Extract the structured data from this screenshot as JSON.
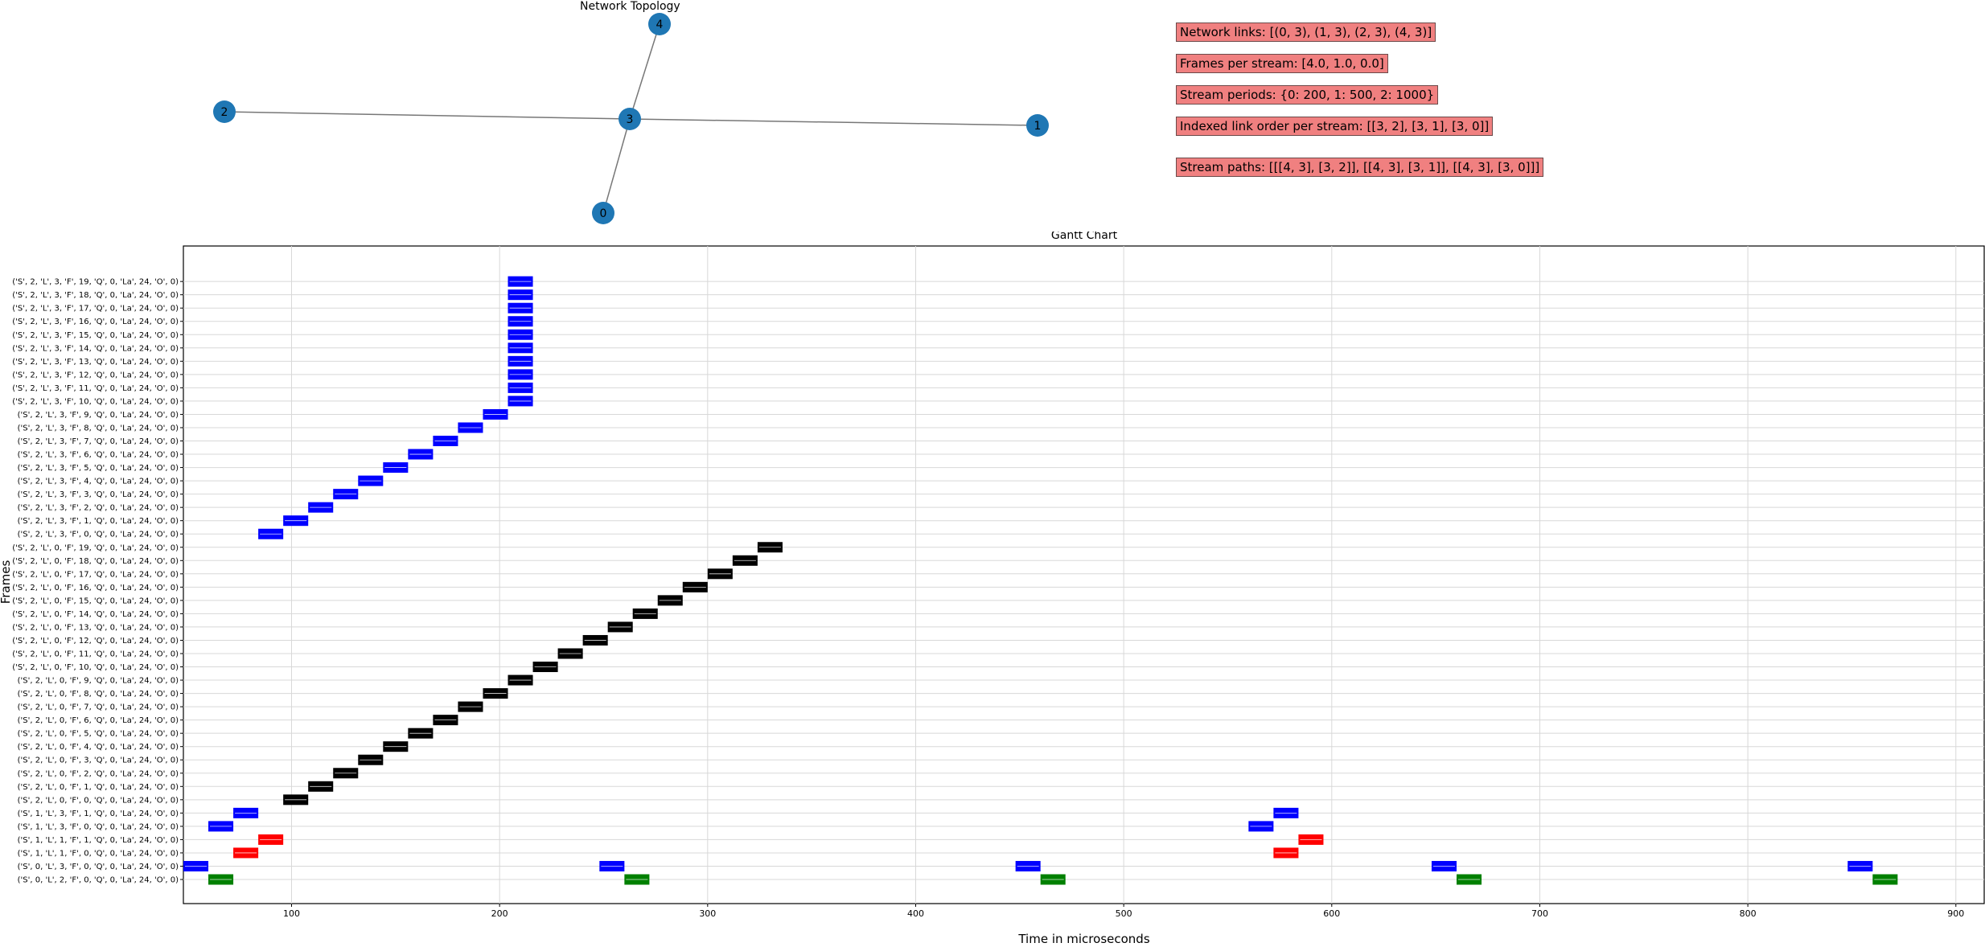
{
  "topology": {
    "title": "Network  Topology",
    "nodes": [
      {
        "id": "4",
        "color": "#1f77b4"
      },
      {
        "id": "2",
        "color": "#1f77b4"
      },
      {
        "id": "3",
        "color": "#1f77b4"
      },
      {
        "id": "1",
        "color": "#1f77b4"
      },
      {
        "id": "0",
        "color": "#1f77b4"
      }
    ],
    "edges": [
      [
        "0",
        "3"
      ],
      [
        "1",
        "3"
      ],
      [
        "2",
        "3"
      ],
      [
        "4",
        "3"
      ]
    ]
  },
  "info": {
    "links": "Network links: [(0, 3), (1, 3), (2, 3), (4, 3)]",
    "frames": "Frames per stream: [4.0, 1.0, 0.0]",
    "periods": "Stream periods: {0: 200, 1: 500, 2: 1000}",
    "link_order": "Indexed link order per stream:  [[3, 2], [3, 1], [3, 0]]",
    "paths": "Stream paths:  [[[4, 3], [3, 2]], [[4, 3], [3, 1]], [[4, 3], [3, 0]]]"
  },
  "chart_data": {
    "type": "gantt",
    "title": "Gantt Chart",
    "xlabel": "Time in microseconds",
    "ylabel": "Frames",
    "xlim": [
      48,
      914
    ],
    "xticks": [
      100,
      200,
      300,
      400,
      500,
      600,
      700,
      800,
      900
    ],
    "grid": true,
    "colors": {
      "blue": "#0000ff",
      "red": "#ff0000",
      "green": "#008000",
      "black": "#000000"
    },
    "rows": [
      {
        "label": "('S', 0, 'L', 2, 'F', 0, 'Q', 0, 'La', 24, 'O', 0)",
        "color": "green",
        "bars": [
          [
            60,
            12
          ],
          [
            260,
            12
          ],
          [
            460,
            12
          ],
          [
            660,
            12
          ],
          [
            860,
            12
          ]
        ]
      },
      {
        "label": "('S', 0, 'L', 3, 'F', 0, 'Q', 0, 'La', 24, 'O', 0)",
        "color": "blue",
        "bars": [
          [
            48,
            12
          ],
          [
            248,
            12
          ],
          [
            448,
            12
          ],
          [
            648,
            12
          ],
          [
            848,
            12
          ]
        ]
      },
      {
        "label": "('S', 1, 'L', 1, 'F', 0, 'Q', 0, 'La', 24, 'O', 0)",
        "color": "red",
        "bars": [
          [
            72,
            12
          ],
          [
            572,
            12
          ]
        ]
      },
      {
        "label": "('S', 1, 'L', 1, 'F', 1, 'Q', 0, 'La', 24, 'O', 0)",
        "color": "red",
        "bars": [
          [
            84,
            12
          ],
          [
            584,
            12
          ]
        ]
      },
      {
        "label": "('S', 1, 'L', 3, 'F', 0, 'Q', 0, 'La', 24, 'O', 0)",
        "color": "blue",
        "bars": [
          [
            60,
            12
          ],
          [
            560,
            12
          ]
        ]
      },
      {
        "label": "('S', 1, 'L', 3, 'F', 1, 'Q', 0, 'La', 24, 'O', 0)",
        "color": "blue",
        "bars": [
          [
            72,
            12
          ],
          [
            572,
            12
          ]
        ]
      },
      {
        "label": "('S', 2, 'L', 0, 'F', 0, 'Q', 0, 'La', 24, 'O', 0)",
        "color": "black",
        "bars": [
          [
            96,
            12
          ]
        ]
      },
      {
        "label": "('S', 2, 'L', 0, 'F', 1, 'Q', 0, 'La', 24, 'O', 0)",
        "color": "black",
        "bars": [
          [
            108,
            12
          ]
        ]
      },
      {
        "label": "('S', 2, 'L', 0, 'F', 2, 'Q', 0, 'La', 24, 'O', 0)",
        "color": "black",
        "bars": [
          [
            120,
            12
          ]
        ]
      },
      {
        "label": "('S', 2, 'L', 0, 'F', 3, 'Q', 0, 'La', 24, 'O', 0)",
        "color": "black",
        "bars": [
          [
            132,
            12
          ]
        ]
      },
      {
        "label": "('S', 2, 'L', 0, 'F', 4, 'Q', 0, 'La', 24, 'O', 0)",
        "color": "black",
        "bars": [
          [
            144,
            12
          ]
        ]
      },
      {
        "label": "('S', 2, 'L', 0, 'F', 5, 'Q', 0, 'La', 24, 'O', 0)",
        "color": "black",
        "bars": [
          [
            156,
            12
          ]
        ]
      },
      {
        "label": "('S', 2, 'L', 0, 'F', 6, 'Q', 0, 'La', 24, 'O', 0)",
        "color": "black",
        "bars": [
          [
            168,
            12
          ]
        ]
      },
      {
        "label": "('S', 2, 'L', 0, 'F', 7, 'Q', 0, 'La', 24, 'O', 0)",
        "color": "black",
        "bars": [
          [
            180,
            12
          ]
        ]
      },
      {
        "label": "('S', 2, 'L', 0, 'F', 8, 'Q', 0, 'La', 24, 'O', 0)",
        "color": "black",
        "bars": [
          [
            192,
            12
          ]
        ]
      },
      {
        "label": "('S', 2, 'L', 0, 'F', 9, 'Q', 0, 'La', 24, 'O', 0)",
        "color": "black",
        "bars": [
          [
            204,
            12
          ]
        ]
      },
      {
        "label": "('S', 2, 'L', 0, 'F', 10, 'Q', 0, 'La', 24, 'O', 0)",
        "color": "black",
        "bars": [
          [
            216,
            12
          ]
        ]
      },
      {
        "label": "('S', 2, 'L', 0, 'F', 11, 'Q', 0, 'La', 24, 'O', 0)",
        "color": "black",
        "bars": [
          [
            228,
            12
          ]
        ]
      },
      {
        "label": "('S', 2, 'L', 0, 'F', 12, 'Q', 0, 'La', 24, 'O', 0)",
        "color": "black",
        "bars": [
          [
            240,
            12
          ]
        ]
      },
      {
        "label": "('S', 2, 'L', 0, 'F', 13, 'Q', 0, 'La', 24, 'O', 0)",
        "color": "black",
        "bars": [
          [
            252,
            12
          ]
        ]
      },
      {
        "label": "('S', 2, 'L', 0, 'F', 14, 'Q', 0, 'La', 24, 'O', 0)",
        "color": "black",
        "bars": [
          [
            264,
            12
          ]
        ]
      },
      {
        "label": "('S', 2, 'L', 0, 'F', 15, 'Q', 0, 'La', 24, 'O', 0)",
        "color": "black",
        "bars": [
          [
            276,
            12
          ]
        ]
      },
      {
        "label": "('S', 2, 'L', 0, 'F', 16, 'Q', 0, 'La', 24, 'O', 0)",
        "color": "black",
        "bars": [
          [
            288,
            12
          ]
        ]
      },
      {
        "label": "('S', 2, 'L', 0, 'F', 17, 'Q', 0, 'La', 24, 'O', 0)",
        "color": "black",
        "bars": [
          [
            300,
            12
          ]
        ]
      },
      {
        "label": "('S', 2, 'L', 0, 'F', 18, 'Q', 0, 'La', 24, 'O', 0)",
        "color": "black",
        "bars": [
          [
            312,
            12
          ]
        ]
      },
      {
        "label": "('S', 2, 'L', 0, 'F', 19, 'Q', 0, 'La', 24, 'O', 0)",
        "color": "black",
        "bars": [
          [
            324,
            12
          ]
        ]
      },
      {
        "label": "('S', 2, 'L', 3, 'F', 0, 'Q', 0, 'La', 24, 'O', 0)",
        "color": "blue",
        "bars": [
          [
            84,
            12
          ]
        ]
      },
      {
        "label": "('S', 2, 'L', 3, 'F', 1, 'Q', 0, 'La', 24, 'O', 0)",
        "color": "blue",
        "bars": [
          [
            96,
            12
          ]
        ]
      },
      {
        "label": "('S', 2, 'L', 3, 'F', 2, 'Q', 0, 'La', 24, 'O', 0)",
        "color": "blue",
        "bars": [
          [
            108,
            12
          ]
        ]
      },
      {
        "label": "('S', 2, 'L', 3, 'F', 3, 'Q', 0, 'La', 24, 'O', 0)",
        "color": "blue",
        "bars": [
          [
            120,
            12
          ]
        ]
      },
      {
        "label": "('S', 2, 'L', 3, 'F', 4, 'Q', 0, 'La', 24, 'O', 0)",
        "color": "blue",
        "bars": [
          [
            132,
            12
          ]
        ]
      },
      {
        "label": "('S', 2, 'L', 3, 'F', 5, 'Q', 0, 'La', 24, 'O', 0)",
        "color": "blue",
        "bars": [
          [
            144,
            12
          ]
        ]
      },
      {
        "label": "('S', 2, 'L', 3, 'F', 6, 'Q', 0, 'La', 24, 'O', 0)",
        "color": "blue",
        "bars": [
          [
            156,
            12
          ]
        ]
      },
      {
        "label": "('S', 2, 'L', 3, 'F', 7, 'Q', 0, 'La', 24, 'O', 0)",
        "color": "blue",
        "bars": [
          [
            168,
            12
          ]
        ]
      },
      {
        "label": "('S', 2, 'L', 3, 'F', 8, 'Q', 0, 'La', 24, 'O', 0)",
        "color": "blue",
        "bars": [
          [
            180,
            12
          ]
        ]
      },
      {
        "label": "('S', 2, 'L', 3, 'F', 9, 'Q', 0, 'La', 24, 'O', 0)",
        "color": "blue",
        "bars": [
          [
            192,
            12
          ]
        ]
      },
      {
        "label": "('S', 2, 'L', 3, 'F', 10, 'Q', 0, 'La', 24, 'O', 0)",
        "color": "blue",
        "bars": [
          [
            204,
            12
          ]
        ]
      },
      {
        "label": "('S', 2, 'L', 3, 'F', 11, 'Q', 0, 'La', 24, 'O', 0)",
        "color": "blue",
        "bars": [
          [
            204,
            12
          ]
        ]
      },
      {
        "label": "('S', 2, 'L', 3, 'F', 12, 'Q', 0, 'La', 24, 'O', 0)",
        "color": "blue",
        "bars": [
          [
            204,
            12
          ]
        ]
      },
      {
        "label": "('S', 2, 'L', 3, 'F', 13, 'Q', 0, 'La', 24, 'O', 0)",
        "color": "blue",
        "bars": [
          [
            204,
            12
          ]
        ]
      },
      {
        "label": "('S', 2, 'L', 3, 'F', 14, 'Q', 0, 'La', 24, 'O', 0)",
        "color": "blue",
        "bars": [
          [
            204,
            12
          ]
        ]
      },
      {
        "label": "('S', 2, 'L', 3, 'F', 15, 'Q', 0, 'La', 24, 'O', 0)",
        "color": "blue",
        "bars": [
          [
            204,
            12
          ]
        ]
      },
      {
        "label": "('S', 2, 'L', 3, 'F', 16, 'Q', 0, 'La', 24, 'O', 0)",
        "color": "blue",
        "bars": [
          [
            204,
            12
          ]
        ]
      },
      {
        "label": "('S', 2, 'L', 3, 'F', 17, 'Q', 0, 'La', 24, 'O', 0)",
        "color": "blue",
        "bars": [
          [
            204,
            12
          ]
        ]
      },
      {
        "label": "('S', 2, 'L', 3, 'F', 18, 'Q', 0, 'La', 24, 'O', 0)",
        "color": "blue",
        "bars": [
          [
            204,
            12
          ]
        ]
      },
      {
        "label": "('S', 2, 'L', 3, 'F', 19, 'Q', 0, 'La', 24, 'O', 0)",
        "color": "blue",
        "bars": [
          [
            204,
            12
          ]
        ]
      }
    ]
  }
}
